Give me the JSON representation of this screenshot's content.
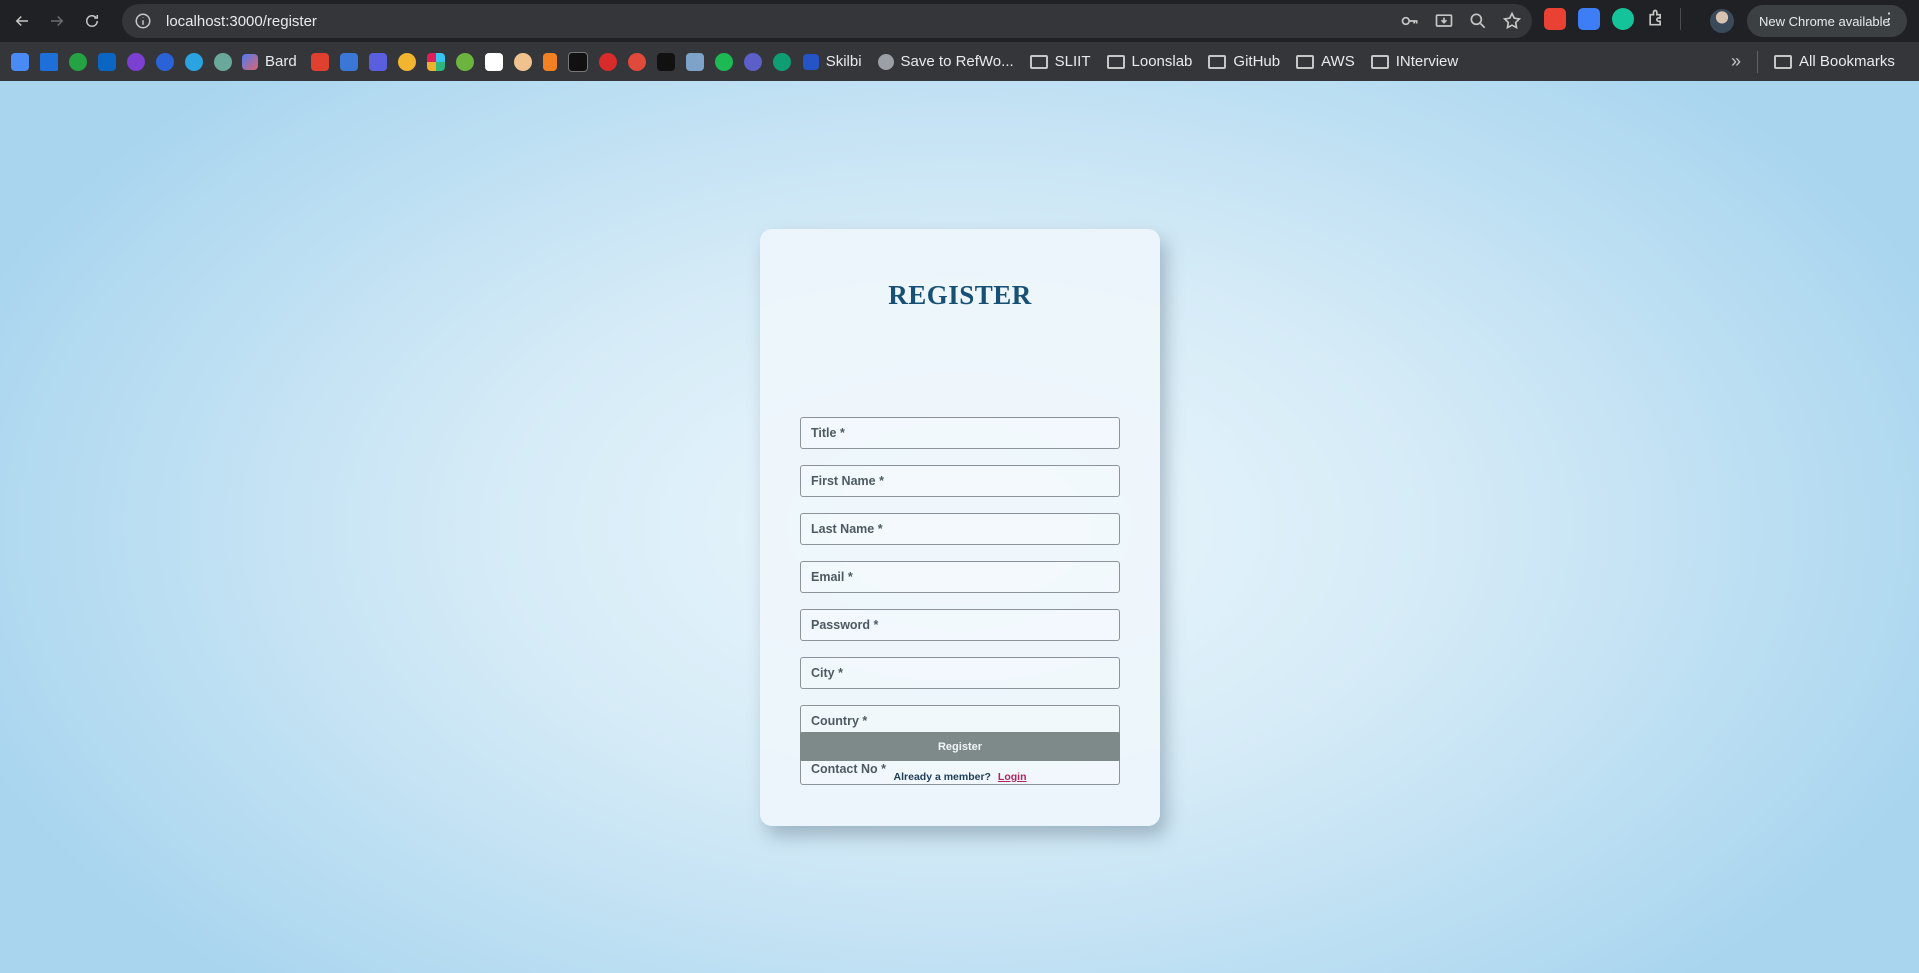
{
  "browser": {
    "url": "localhost:3000/register",
    "new_chrome_label": "New Chrome available",
    "bookmarks": [
      {
        "label": "Bard"
      },
      {
        "label": "Skilbi"
      },
      {
        "label": "Save to RefWo..."
      },
      {
        "label": "SLIIT"
      },
      {
        "label": "Loonslab"
      },
      {
        "label": "GitHub"
      },
      {
        "label": "AWS"
      },
      {
        "label": "INterview"
      }
    ],
    "all_bookmarks_label": "All Bookmarks",
    "extension_colors": [
      "#e94235",
      "#3d7df5",
      "#15c39a",
      "#c4c7c5"
    ]
  },
  "form": {
    "title": "REGISTER",
    "fields": {
      "title": "Title *",
      "first_name": "First Name *",
      "last_name": "Last Name *",
      "email": "Email *",
      "password": "Password *",
      "city": "City *",
      "country": "Country *",
      "contact_no": "Contact No *"
    },
    "submit_label": "Register",
    "member_prompt": "Already a member?",
    "login_link": "Login"
  },
  "colors": {
    "heading": "#175074",
    "button": "#7e8a8a",
    "link": "#b0255a"
  }
}
